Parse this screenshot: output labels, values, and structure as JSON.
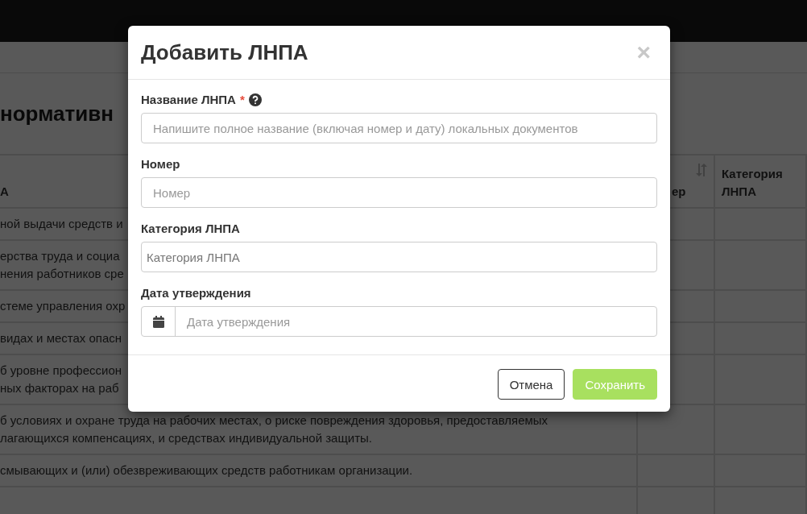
{
  "page": {
    "heading": "нормативн",
    "table": {
      "columns": [
        {
          "label": "А"
        },
        {
          "label": "ер",
          "sortable": true
        },
        {
          "label": "Категория ЛНПА"
        }
      ],
      "rows": [
        {
          "lines": [
            "ной выдачи средств и"
          ]
        },
        {
          "lines": [
            "ерства труда и социа",
            "нения работников сре"
          ]
        },
        {
          "lines": [
            "стеме управления охр"
          ]
        },
        {
          "lines": [
            "видах и местах опасн"
          ]
        },
        {
          "lines": [
            "б уровне профессион",
            "ных факторах на раб"
          ]
        },
        {
          "lines": [
            "б условиях и охране труда на рабочих местах, о риске повреждения здоровья, предоставляемых",
            "лагающихся компенсациях, и средствах индивидуальной защиты."
          ]
        },
        {
          "lines": [
            "смывающих и (или) обезвреживающих средств работникам организации."
          ]
        }
      ]
    }
  },
  "dialog": {
    "title": "Добавить ЛНПА",
    "close": "×",
    "fields": [
      {
        "kind": "text",
        "label": "Название ЛНПА",
        "required_mark": "*",
        "help": true,
        "placeholder": "Напишите полное название (включая номер и дату) локальных документов"
      },
      {
        "kind": "text",
        "label": "Номер",
        "help": false,
        "placeholder": "Номер"
      },
      {
        "kind": "select",
        "label": "Категория ЛНПА",
        "help": false,
        "placeholder": "Категория ЛНПА"
      },
      {
        "kind": "date",
        "label": "Дата утверждения",
        "help": false,
        "placeholder": "Дата утверждения"
      }
    ],
    "buttons": [
      {
        "kind": "secondary",
        "label": "Отмена"
      },
      {
        "kind": "primary",
        "label": "Сохранить"
      }
    ]
  }
}
